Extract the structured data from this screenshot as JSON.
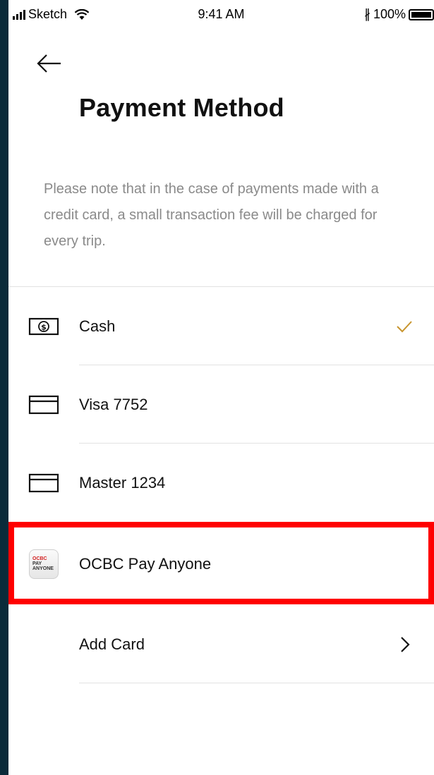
{
  "status_bar": {
    "carrier": "Sketch",
    "time": "9:41 AM",
    "battery_percent": "100%"
  },
  "header": {
    "back_icon": "arrow-left-icon",
    "title": "Payment Method"
  },
  "notice": "Please note that in the case of payments made with a credit card, a small transaction fee will be charged for every trip.",
  "payment_methods": [
    {
      "label": "Cash",
      "icon": "cash-icon",
      "selected": true
    },
    {
      "label": "Visa 7752",
      "icon": "credit-card-icon",
      "selected": false
    },
    {
      "label": "Master 1234",
      "icon": "credit-card-icon",
      "selected": false
    },
    {
      "label": "OCBC Pay Anyone",
      "icon": "ocbc-pay-anyone-logo",
      "selected": false,
      "logo_text": [
        "OCBC",
        "PAY",
        "ANYONE"
      ]
    }
  ],
  "add_card": {
    "label": "Add Card",
    "icon": "chevron-right-icon"
  },
  "colors": {
    "accent_check": "#c8952e",
    "highlight": "#ff0000",
    "notice_text": "#8a8a8a",
    "background_outer": "#0b2b3a"
  }
}
